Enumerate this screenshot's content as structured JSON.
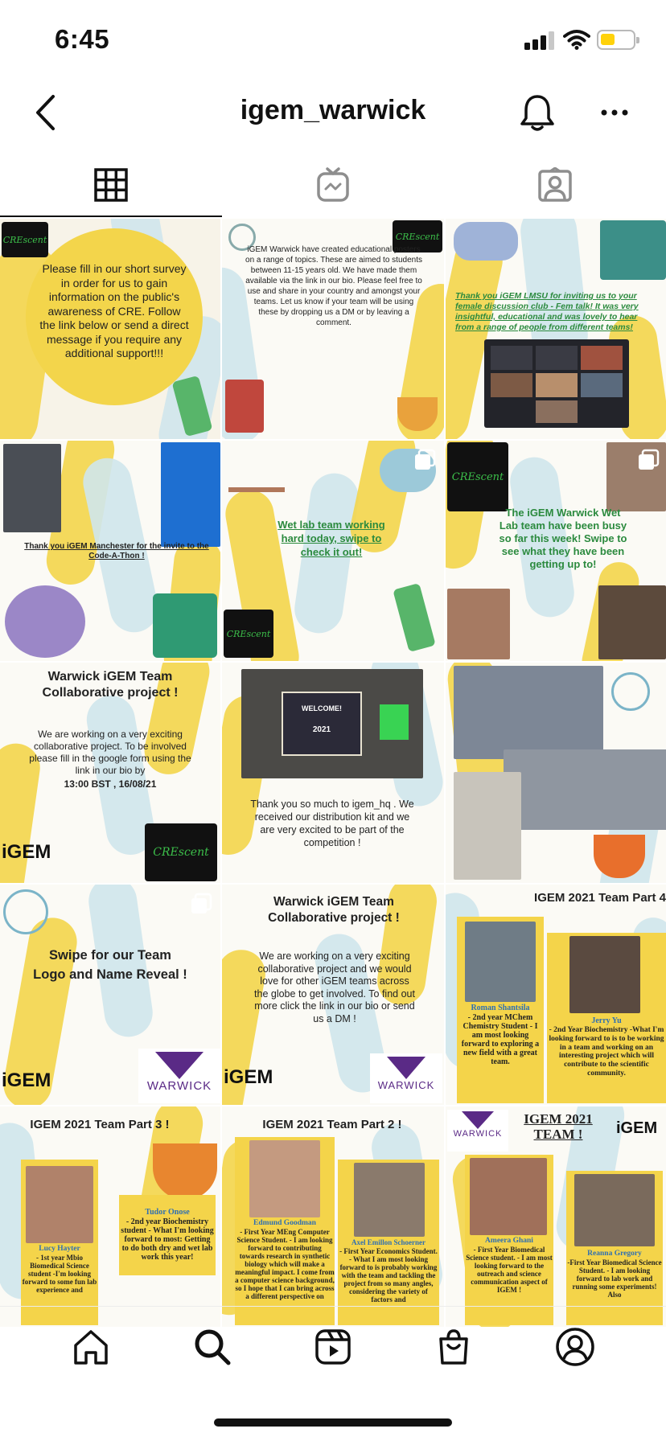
{
  "status_bar": {
    "time": "6:45",
    "battery_color": "#ffd20a"
  },
  "header": {
    "username": "igem_warwick",
    "icons": [
      "back-arrow-icon",
      "bell-icon",
      "more-icon"
    ]
  },
  "tabs": [
    {
      "name": "grid",
      "icon": "grid-icon",
      "active": true
    },
    {
      "name": "igtv",
      "icon": "igtv-icon",
      "active": false
    },
    {
      "name": "tagged",
      "icon": "tagged-icon",
      "active": false
    }
  ],
  "posts": [
    {
      "text": "Please fill in our short survey in order for us to gain information on the public's awareness of CRE. Follow the link below or send a direct message if you require any additional support!!!",
      "badge": "CREscent"
    },
    {
      "text": "iGEM Warwick have created educational posters on a range of topics. These are aimed to students between 11-15 years old. We have made them available via the link in our bio. Please feel free to use and share in your country and amongst your teams. Let us know if your team will be using these by dropping us a DM or by leaving a comment.",
      "badge": "CREscent"
    },
    {
      "text": "Thank you iGEM LMSU for inviting us to your female discussion club - Fem talk! It was very insightful, educational and was lovely to hear from a range of people from different teams!"
    },
    {
      "text": "Thank you iGEM Manchester for the invite to the Code-A-Thon !"
    },
    {
      "text": "Wet lab team working hard today, swipe to check it out!",
      "badge": "CREscent"
    },
    {
      "text": "The iGEM Warwick Wet Lab team have been busy so far this week! Swipe to see what they have been getting up to!",
      "badge": "CREscent"
    },
    {
      "title": "Warwick iGEM Team Collaborative project !",
      "text": "We are working on a very exciting collaborative project. To be involved please fill in the google form using the link in our bio by",
      "deadline": "13:00 BST , 16/08/21",
      "logo": "iGEM",
      "badge": "CREscent"
    },
    {
      "text": "Thank you so much to igem_hq . We received our distribution kit and we are very excited to be part of the competition !",
      "box_label": "WELCOME!",
      "box_year": "2021"
    },
    {
      "text": ""
    },
    {
      "text": "Swipe for our Team Logo and Name Reveal !",
      "logo": "iGEM",
      "warwick": "WARWICK",
      "warwick_sub": "THE UNIVERSITY OF WARWICK"
    },
    {
      "title": "Warwick iGEM Team Collaborative project !",
      "text": "We are working on a very exciting collaborative project and we would love for other iGEM teams across the globe to get involved. To find out more click the link in our bio or send us a DM !",
      "logo": "iGEM",
      "warwick": "WARWICK",
      "warwick_sub": "THE UNIVERSITY OF WARWICK"
    },
    {
      "title": "IGEM 2021 Team Part 4",
      "member1_name": "Roman Shantsila",
      "member1_text": "- 2nd year MChem Chemistry Student - I am most looking forward to exploring a new field with a great team.",
      "member2_name": "Jerry Yu",
      "member2_text": "- 2nd Year Biochemistry -What I'm looking forward to is to be working in a team and working on an interesting project which will contribute to the scientific community."
    },
    {
      "title": "IGEM 2021 Team Part 3 !",
      "member1_name": "Lucy Hayter",
      "member1_text": "- 1st year Mbio Biomedical Science student -I'm looking forward to some fun lab experience and",
      "member2_name": "Tudor Onose",
      "member2_text": "- 2nd year Biochemistry student - What I'm looking forward to most: Getting to do both dry and wet lab work this year!"
    },
    {
      "title": "IGEM 2021 Team Part 2 !",
      "member1_name": "Edmund Goodman",
      "member1_text": "- First Year MEng Computer Science Student. - I am looking forward to contributing towards research in synthetic biology which will make a meaningful impact. I come from a computer science background, so I hope that I can bring across a different perspective on",
      "member2_name": "Axel Emillon Schoerner",
      "member2_text": "- First Year Economics Student. - What I am most looking forward to is probably working with the team and tackling the project from so many angles, considering the variety of factors and"
    },
    {
      "title": "IGEM 2021 TEAM !",
      "warwick": "WARWICK",
      "warwick_sub": "THE UNIVERSITY OF WARWICK",
      "logo": "iGEM",
      "member1_name": "Ameera Ghani",
      "member1_text": "- First Year Biomedical Science student. - I am most looking forward to the outreach and science communication aspect of IGEM !",
      "member2_name": "Reanna Gregory",
      "member2_text": "-First Year Biomedical Science Student. - I am looking forward to lab work and running some experiments! Also"
    }
  ],
  "bottom_nav": [
    "home-icon",
    "search-icon",
    "reels-icon",
    "shop-icon",
    "profile-icon"
  ]
}
